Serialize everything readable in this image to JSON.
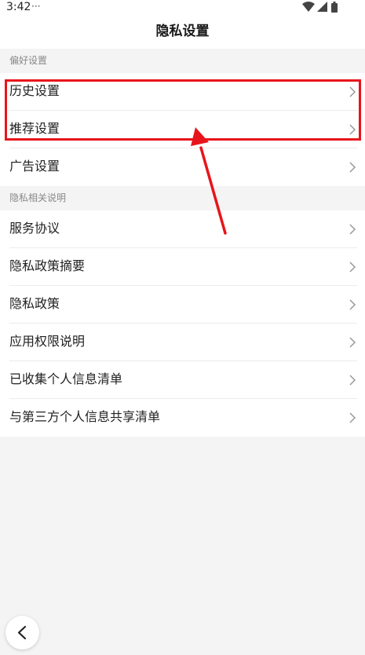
{
  "status_bar": {
    "time": "3:42",
    "dots": "···",
    "icons": [
      "wifi-icon",
      "signal-icon",
      "battery-icon"
    ]
  },
  "header": {
    "title": "隐私设置"
  },
  "sections": [
    {
      "title": "偏好设置",
      "items": [
        {
          "label": "历史设置"
        },
        {
          "label": "推荐设置"
        },
        {
          "label": "广告设置"
        }
      ]
    },
    {
      "title": "隐私相关说明",
      "items": [
        {
          "label": "服务协议"
        },
        {
          "label": "隐私政策摘要"
        },
        {
          "label": "隐私政策"
        },
        {
          "label": "应用权限说明"
        },
        {
          "label": "已收集个人信息清单"
        },
        {
          "label": "与第三方个人信息共享清单"
        }
      ]
    }
  ],
  "annotation": {
    "color": "#e8141b"
  },
  "back_button": {
    "icon": "chevron-left-icon"
  }
}
